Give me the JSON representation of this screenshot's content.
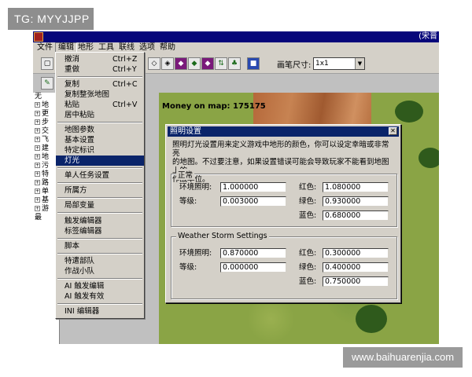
{
  "watermarks": {
    "top": "TG: MYYJJPP",
    "bottom": "www.baihuarenjia.com"
  },
  "window": {
    "title_right": "(宋晋"
  },
  "menubar": [
    "文件",
    "编辑",
    "地形",
    "工具",
    "联线",
    "选项",
    "帮助"
  ],
  "toolbar": {
    "brush_size_label": "画笔尺寸:",
    "brush_size_value": "1x1"
  },
  "tree": {
    "items": [
      "无",
      "地",
      "更",
      "步",
      "交",
      "飞",
      "建",
      "地",
      "污",
      "特",
      "路",
      "单",
      "基",
      "游",
      "最"
    ]
  },
  "map": {
    "money_text": "Money on map: 175175"
  },
  "edit_menu": {
    "items": [
      {
        "label": "撤消",
        "shortcut": "Ctrl+Z"
      },
      {
        "label": "重做",
        "shortcut": "Ctrl+Y"
      },
      {
        "label": "复制",
        "shortcut": "Ctrl+C"
      },
      {
        "label": "复制整张地图",
        "shortcut": ""
      },
      {
        "label": "粘贴",
        "shortcut": "Ctrl+V"
      },
      {
        "label": "居中粘贴",
        "shortcut": ""
      },
      {
        "label": "地图参数",
        "shortcut": ""
      },
      {
        "label": "基本设置",
        "shortcut": ""
      },
      {
        "label": "特定标识",
        "shortcut": ""
      },
      {
        "label": "灯光",
        "shortcut": ""
      },
      {
        "label": "单人任务设置",
        "shortcut": ""
      },
      {
        "label": "所属方",
        "shortcut": ""
      },
      {
        "label": "局部变量",
        "shortcut": ""
      },
      {
        "label": "触发编辑器",
        "shortcut": ""
      },
      {
        "label": "标签编辑器",
        "shortcut": ""
      },
      {
        "label": "脚本",
        "shortcut": ""
      },
      {
        "label": "特遣部队",
        "shortcut": ""
      },
      {
        "label": "作战小队",
        "shortcut": ""
      },
      {
        "label": "AI 触发编辑",
        "shortcut": ""
      },
      {
        "label": "AI 触发有效",
        "shortcut": ""
      },
      {
        "label": "INI 编辑器",
        "shortcut": ""
      }
    ],
    "selected": "灯光"
  },
  "dialog": {
    "title": "照明设置",
    "close": "✕",
    "description_line1": "照明灯光设置用来定义游戏中地形的颜色，你可以设定幸暗或非常亮",
    "description_line2": "的地图。不过要注意，如果设置错误可能会导致玩家不能看到地图上的",
    "description_line3": "作战单位。",
    "normal": {
      "label": "正常",
      "ambient_label": "环境照明:",
      "ambient": "1.000000",
      "level_label": "等级:",
      "level": "0.003000",
      "red_label": "红色:",
      "red": "1.080000",
      "green_label": "绿色:",
      "green": "0.930000",
      "blue_label": "蓝色:",
      "blue": "0.680000"
    },
    "storm": {
      "label": "Weather Storm Settings",
      "ambient_label": "环境照明:",
      "ambient": "0.870000",
      "level_label": "等级:",
      "level": "0.000000",
      "red_label": "红色:",
      "red": "0.300000",
      "green_label": "绿色:",
      "green": "0.400000",
      "blue_label": "蓝色:",
      "blue": "0.750000"
    }
  }
}
